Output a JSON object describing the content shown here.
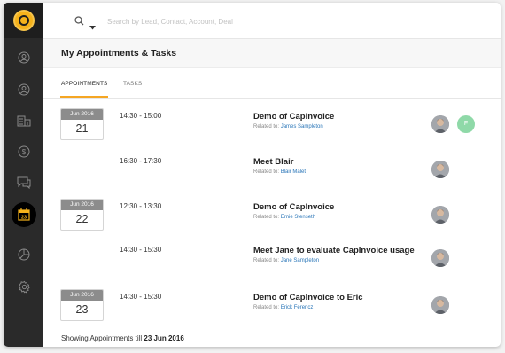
{
  "search": {
    "placeholder": "Search by Lead, Contact, Account, Deal"
  },
  "page": {
    "title": "My Appointments & Tasks"
  },
  "tabs": [
    {
      "label": "APPOINTMENTS",
      "active": true
    },
    {
      "label": "TASKS",
      "active": false
    }
  ],
  "sidebar": {
    "icons": [
      "user-circle-icon",
      "user-circle-icon",
      "building-icon",
      "dollar-icon",
      "chat-icon",
      "calendar-icon",
      "pie-chart-icon",
      "gear-icon"
    ],
    "active_day": "23"
  },
  "appointments": [
    {
      "month": "Jun 2016",
      "day": "21",
      "time": "14:30 - 15:00",
      "title": "Demo of CapInvoice",
      "related_prefix": "Related to:",
      "related_name": "James Sampleton",
      "extra_initial": "F"
    },
    {
      "time": "16:30 - 17:30",
      "title": "Meet Blair",
      "related_prefix": "Related to:",
      "related_name": "Blair Malet"
    },
    {
      "month": "Jun 2016",
      "day": "22",
      "time": "12:30 - 13:30",
      "title": "Demo of CapInvoice",
      "related_prefix": "Related to:",
      "related_name": "Ernie Stenseth"
    },
    {
      "time": "14:30 - 15:30",
      "title": "Meet Jane to evaluate CapInvoice usage",
      "related_prefix": "Related to:",
      "related_name": "Jane Sampleton"
    },
    {
      "month": "Jun 2016",
      "day": "23",
      "time": "14:30 - 15:30",
      "title": "Demo of CapInvoice to Eric",
      "related_prefix": "Related to:",
      "related_name": "Erick Ferencz"
    }
  ],
  "footer": {
    "prefix": "Showing Appointments till",
    "date": "23 Jun 2016"
  },
  "colors": {
    "accent": "#f5a623",
    "link": "#2a76b8",
    "sidebar": "#2a2a2a"
  }
}
